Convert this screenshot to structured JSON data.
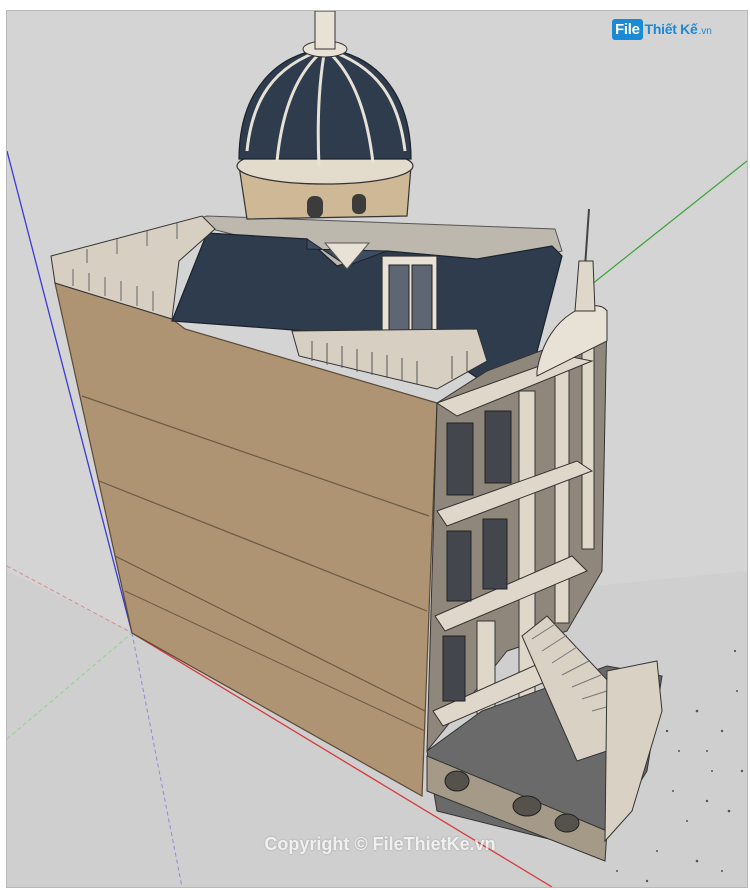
{
  "watermark": {
    "logo_file": "File",
    "logo_rest": "Thiết Kế",
    "logo_tld": ".vn",
    "copyright": "Copyright © FileThietKe.vn"
  },
  "icons": {
    "logo": "file-thiet-ke-logo-icon"
  },
  "colors": {
    "viewport_bg": "#d4d4d4",
    "wall": "#ae9473",
    "roof": "#2e3c4e",
    "trim": "#e8e2d6",
    "axis_red": "#d63a3a",
    "axis_green": "#3aa63a",
    "axis_blue": "#3a3ad6",
    "logo_blue": "#1b8ad6"
  }
}
